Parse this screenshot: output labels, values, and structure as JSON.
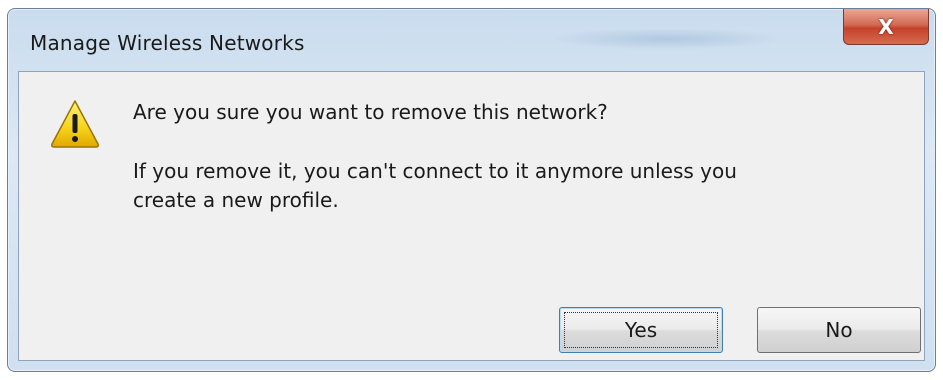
{
  "window": {
    "title": "Manage Wireless Networks",
    "close_button": {
      "glyph": "X",
      "icon": "close-icon",
      "color": "#c4422a"
    }
  },
  "dialog": {
    "icon": "warning-icon",
    "main_instruction": "Are you sure you want to remove this network?",
    "content_line1": "If you remove it, you can't connect to it anymore unless you",
    "content_line2": "create a new profile."
  },
  "buttons": {
    "yes_label": "Yes",
    "no_label": "No",
    "default": "yes"
  },
  "colors": {
    "frame": "#cfe0f0",
    "client_background": "#f0f0f0",
    "warning_yellow": "#f6d21a"
  }
}
